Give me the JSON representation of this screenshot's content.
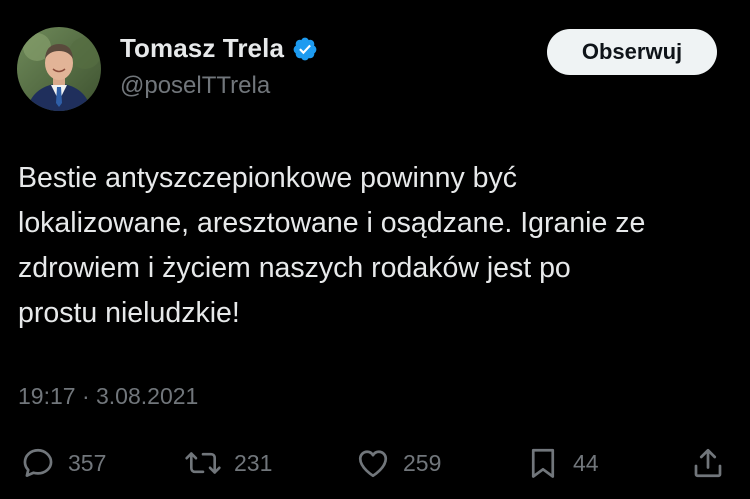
{
  "author": {
    "name": "Tomasz Trela",
    "handle": "@poselTTrela",
    "verified": true,
    "avatar": "profile-photo"
  },
  "follow_button": {
    "label": "Obserwuj"
  },
  "tweet": {
    "lines": [
      "Bestie antyszczepionkowe powinny być",
      "lokalizowane, aresztowane i osądzane. Igranie ze",
      "zdrowiem i życiem naszych rodaków jest po",
      "prostu nieludzkie!"
    ],
    "timestamp": "19:17 · 3.08.2021"
  },
  "actions": {
    "replies": "357",
    "retweets": "231",
    "likes": "259",
    "bookmarks": "44"
  },
  "colors": {
    "background": "#000000",
    "text": "#e7e9ea",
    "muted": "#71767b",
    "verified": "#1d9bf0",
    "button_bg": "#eff3f4"
  },
  "icons": {
    "verified": "verified-badge-icon",
    "reply": "reply-icon",
    "retweet": "retweet-icon",
    "like": "heart-icon",
    "bookmark": "bookmark-icon",
    "share": "share-icon"
  }
}
